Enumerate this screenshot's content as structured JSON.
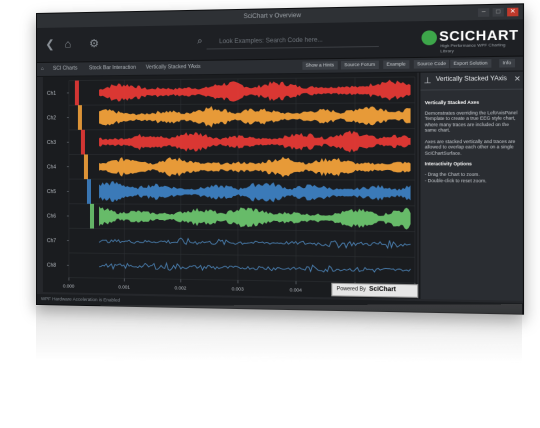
{
  "window": {
    "title": "SciChart v Overview"
  },
  "window_buttons": [
    "–",
    "□",
    "✕"
  ],
  "toolbar": {
    "search_placeholder": "Look Examples: Search Code here...",
    "icons": [
      "back-icon",
      "home-icon",
      "settings-icon"
    ]
  },
  "logo": {
    "name": "SCICHART",
    "tagline": "High Performance WPF Charting Library"
  },
  "breadcrumbs": [
    "SCI Charts",
    "Stock Bar Interaction",
    "Vertically Stacked YAxis"
  ],
  "toolbar_chips": [
    "Show a Hints",
    "Source Forum",
    "Example",
    "Source Code",
    "Export Solution",
    "Info"
  ],
  "panel": {
    "title": "Vertically Stacked YAxis",
    "section1_title": "Vertically Stacked Axes",
    "section1_text": "Demonstrates overriding the LeftAxisPanel Template to create a true EEG style chart, where many traces are included on the same chart.",
    "section1_text2": "Axes are stacked vertically and traces are allowed to overlap each other on a single SciChartSurface.",
    "section2_title": "Interactivity Options",
    "section2_items": [
      "- Drag the Chart to zoom.",
      "- Double-click to reset zoom."
    ]
  },
  "badge": {
    "label": "Powered By",
    "brand": "SciChart"
  },
  "statusbar": {
    "text": "WPF Hardware Acceleration is Enabled"
  },
  "chart_data": {
    "type": "line",
    "description_axes": [
      "Ch1",
      "Ch2",
      "Ch3",
      "Ch4",
      "Ch5",
      "Ch6",
      "Ch7",
      "Ch8"
    ],
    "x_ticks": [
      "0.000",
      "0.001",
      "0.002",
      "0.003",
      "0.004",
      "0.005",
      "0.006"
    ],
    "series_colors": [
      "#e53935",
      "#f2a13a",
      "#e53935",
      "#f2a13a",
      "#3d7fc1",
      "#6cc46e",
      "#4a7fb0",
      "#4a7fb0"
    ]
  }
}
